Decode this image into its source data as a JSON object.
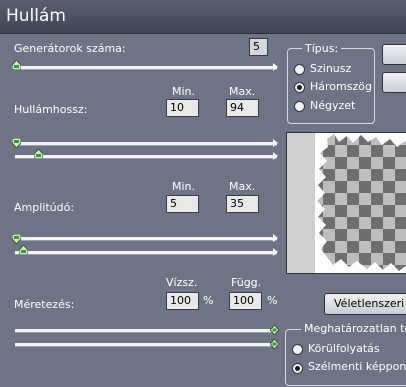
{
  "window": {
    "title": "Hullám"
  },
  "generators": {
    "label": "Generátorok száma:",
    "value": "5"
  },
  "wavelength": {
    "label": "Hullámhossz:",
    "min_label": "Min.",
    "max_label": "Max.",
    "min_value": "10",
    "max_value": "94"
  },
  "amplitude": {
    "label": "Amplitúdó:",
    "min_label": "Min.",
    "max_label": "Max.",
    "min_value": "5",
    "max_value": "35"
  },
  "scale": {
    "label": "Méretezés:",
    "horiz_label": "Vízsz.",
    "vert_label": "Függ.",
    "horiz_value": "100",
    "vert_value": "100",
    "percent": "%"
  },
  "type_group": {
    "label": "Típus:",
    "options": [
      "Szinusz",
      "Háromszög",
      "Négyzet"
    ],
    "selected": "Háromszög"
  },
  "undefined_group": {
    "label": "Meghatározatlan terü",
    "options": [
      "Körülfolyatás",
      "Szélmenti képpontok"
    ],
    "selected": "Szélmenti képpontok"
  },
  "randomize_button": {
    "label": "Véletlenszeri"
  },
  "colors": {
    "background": "#6e7486",
    "titlebar": "#4a4f5e",
    "preview_dark": "#6f6f6f",
    "preview_light": "#bdbdbd"
  }
}
